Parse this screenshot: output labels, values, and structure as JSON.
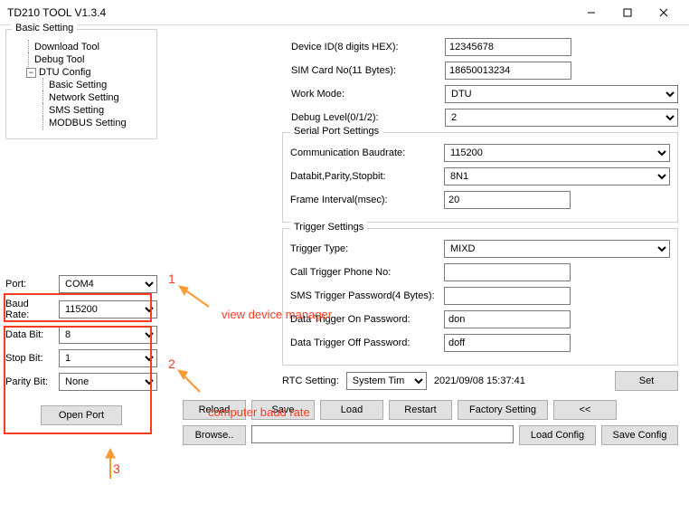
{
  "window": {
    "title": "TD210 TOOL V1.3.4"
  },
  "tree": {
    "group": "Basic Setting",
    "items": {
      "download": "Download Tool",
      "debug": "Debug Tool",
      "dtu": "DTU Config",
      "basic": "Basic Setting",
      "network": "Network Setting",
      "sms": "SMS Setting",
      "modbus": "MODBUS Setting"
    }
  },
  "port_panel": {
    "port_label": "Port:",
    "port_value": "COM4",
    "baud_label": "Baud Rate:",
    "baud_value": "115200",
    "databit_label": "Data Bit:",
    "databit_value": "8",
    "stopbit_label": "Stop Bit:",
    "stopbit_value": "1",
    "parity_label": "Parity Bit:",
    "parity_value": "None",
    "open_port": "Open Port"
  },
  "device": {
    "id_label": "Device ID(8 digits HEX):",
    "id_value": "12345678",
    "sim_label": "SIM Card No(11 Bytes):",
    "sim_value": "18650013234",
    "mode_label": "Work Mode:",
    "mode_value": "DTU",
    "debug_label": "Debug Level(0/1/2):",
    "debug_value": "2"
  },
  "serial": {
    "legend": "Serial Port Settings",
    "baud_label": "Communication Baudrate:",
    "baud_value": "115200",
    "dps_label": "Databit,Parity,Stopbit:",
    "dps_value": "8N1",
    "frame_label": "Frame Interval(msec):",
    "frame_value": "20"
  },
  "trigger": {
    "legend": "Trigger Settings",
    "type_label": "Trigger Type:",
    "type_value": "MIXD",
    "phone_label": "Call Trigger Phone No:",
    "phone_value": "",
    "smspw_label": "SMS Trigger Password(4 Bytes):",
    "smspw_value": "",
    "onpw_label": "Data Trigger On Password:",
    "onpw_value": "don",
    "offpw_label": "Data Trigger Off Password:",
    "offpw_value": "doff"
  },
  "rtc": {
    "label": "RTC Setting:",
    "mode": "System Tim",
    "time": "2021/09/08 15:37:41",
    "set": "Set"
  },
  "buttons": {
    "reload": "Reload",
    "save": "Save",
    "load": "Load",
    "restart": "Restart",
    "factory": "Factory Setting",
    "back": "<<",
    "browse": "Browse..",
    "loadcfg": "Load Config",
    "savecfg": "Save Config"
  },
  "annotations": {
    "n1": "1",
    "n2": "2",
    "n3": "3",
    "view_mgr": "view device manager",
    "comp_baud": "computer baud rate"
  }
}
